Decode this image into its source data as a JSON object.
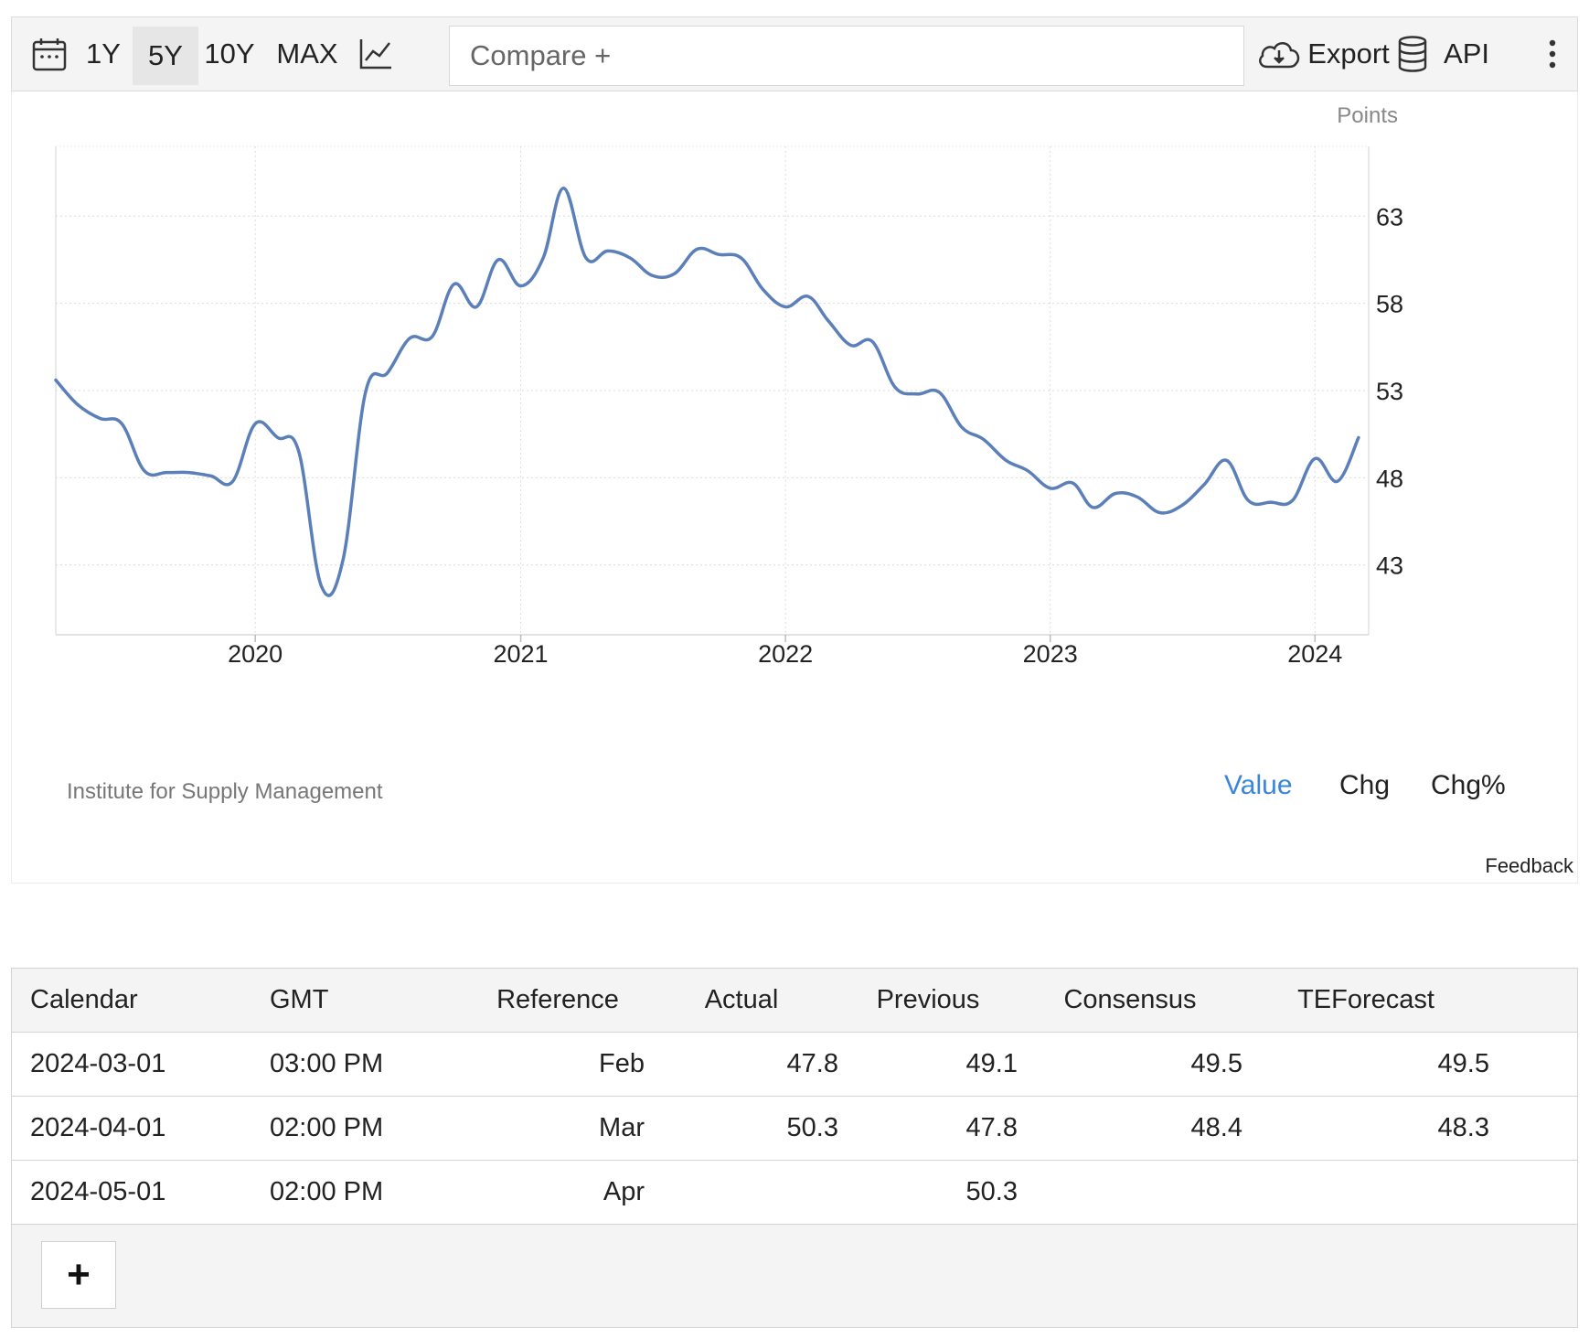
{
  "toolbar": {
    "calendar_icon": "calendar-icon",
    "ranges": [
      "1Y",
      "5Y",
      "10Y",
      "MAX"
    ],
    "active_range": "5Y",
    "chart_type_icon": "line-chart-icon",
    "compare_placeholder": "Compare +",
    "export_icon": "cloud-download-icon",
    "export_label": "Export",
    "api_icon": "database-icon",
    "api_label": "API",
    "more_icon": "more-vertical-icon"
  },
  "chart": {
    "unit_label": "Points",
    "source": "Institute for Supply Management",
    "modes": [
      "Value",
      "Chg",
      "Chg%"
    ],
    "active_mode": "Value",
    "feedback": "Feedback",
    "line_color": "#5b7fb8",
    "active_color": "#3b86d8"
  },
  "chart_data": {
    "type": "line",
    "title": "",
    "xlabel": "",
    "ylabel": "Points",
    "x_ticks": [
      "2020",
      "2021",
      "2022",
      "2023",
      "2024"
    ],
    "y_ticks": [
      43,
      48,
      53,
      58,
      63
    ],
    "ylim": [
      39.0,
      67.0
    ],
    "xlim": [
      "2019-04-01",
      "2024-03-15"
    ],
    "grid": true,
    "axis_position": "right",
    "series": [
      {
        "x": [
          "2019-04-01",
          "2019-05-01",
          "2019-06-01",
          "2019-07-01",
          "2019-08-01",
          "2019-09-01",
          "2019-10-01",
          "2019-11-01",
          "2019-12-01",
          "2020-01-01",
          "2020-02-01",
          "2020-03-01",
          "2020-04-01",
          "2020-05-01",
          "2020-06-01",
          "2020-07-01",
          "2020-08-01",
          "2020-09-01",
          "2020-10-01",
          "2020-11-01",
          "2020-12-01",
          "2021-01-01",
          "2021-02-01",
          "2021-03-01",
          "2021-04-01",
          "2021-05-01",
          "2021-06-01",
          "2021-07-01",
          "2021-08-01",
          "2021-09-01",
          "2021-10-01",
          "2021-11-01",
          "2021-12-01",
          "2022-01-01",
          "2022-02-01",
          "2022-03-01",
          "2022-04-01",
          "2022-05-01",
          "2022-06-01",
          "2022-07-01",
          "2022-08-01",
          "2022-09-01",
          "2022-10-01",
          "2022-11-01",
          "2022-12-01",
          "2023-01-01",
          "2023-02-01",
          "2023-03-01",
          "2023-04-01",
          "2023-05-01",
          "2023-06-01",
          "2023-07-01",
          "2023-08-01",
          "2023-09-01",
          "2023-10-01",
          "2023-11-01",
          "2023-12-01",
          "2024-01-01",
          "2024-02-01",
          "2024-03-01"
        ],
        "y": [
          53.6,
          52.2,
          51.4,
          51.1,
          48.4,
          48.3,
          48.3,
          48.1,
          47.8,
          51.1,
          50.3,
          49.5,
          41.8,
          43.3,
          52.9,
          54.0,
          56.0,
          56.1,
          59.1,
          57.8,
          60.5,
          59.0,
          60.6,
          64.6,
          60.6,
          61.0,
          60.6,
          59.6,
          59.7,
          61.1,
          60.8,
          60.6,
          58.8,
          57.8,
          58.4,
          57.0,
          55.6,
          55.8,
          53.2,
          52.8,
          52.9,
          50.9,
          50.2,
          49.0,
          48.4,
          47.4,
          47.7,
          46.3,
          47.1,
          46.9,
          46.0,
          46.4,
          47.6,
          49.0,
          46.7,
          46.6,
          46.7,
          49.1,
          47.8,
          50.3
        ]
      }
    ]
  },
  "table": {
    "headers": [
      "Calendar",
      "GMT",
      "Reference",
      "Actual",
      "Previous",
      "Consensus",
      "TEForecast"
    ],
    "rows": [
      [
        "2024-03-01",
        "03:00 PM",
        "Feb",
        "47.8",
        "49.1",
        "49.5",
        "49.5"
      ],
      [
        "2024-04-01",
        "02:00 PM",
        "Mar",
        "50.3",
        "47.8",
        "48.4",
        "48.3"
      ],
      [
        "2024-05-01",
        "02:00 PM",
        "Apr",
        "",
        "50.3",
        "",
        ""
      ]
    ],
    "add_label": "+"
  }
}
